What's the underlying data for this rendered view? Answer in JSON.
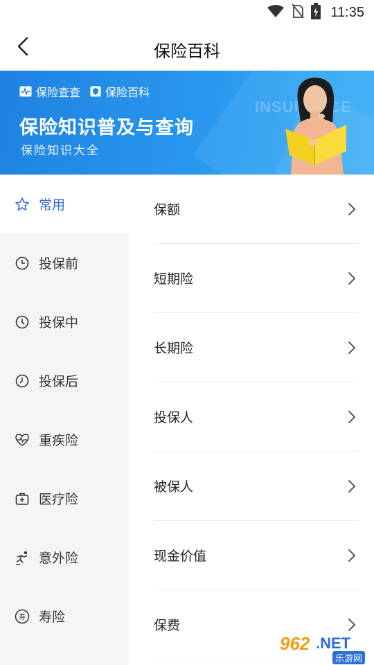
{
  "status_bar": {
    "time": "11:35",
    "icons": [
      "wifi-icon",
      "no-sim-icon",
      "battery-charging-icon"
    ]
  },
  "header": {
    "title": "保险百科",
    "back_icon": "chevron-left-icon"
  },
  "banner": {
    "tag_1": "保险查查",
    "tag_2": "保险百科",
    "headline": "保险知识普及与查询",
    "subline": "保险知识大全",
    "watermark": "INSURANCE",
    "colors": {
      "start": "#1e82e0",
      "end": "#37aef7"
    }
  },
  "sidebar": {
    "active_index": 0,
    "active_color": "#2f6fd8",
    "items": [
      {
        "label": "常用",
        "icon": "star-icon"
      },
      {
        "label": "投保前",
        "icon": "clock-icon"
      },
      {
        "label": "投保中",
        "icon": "clock-icon"
      },
      {
        "label": "投保后",
        "icon": "clock-icon"
      },
      {
        "label": "重疾险",
        "icon": "heartbeat-icon"
      },
      {
        "label": "医疗险",
        "icon": "medical-kit-icon"
      },
      {
        "label": "意外险",
        "icon": "falling-person-icon"
      },
      {
        "label": "寿险",
        "icon": "longevity-icon"
      }
    ]
  },
  "list": {
    "items": [
      "保额",
      "短期险",
      "长期险",
      "投保人",
      "被保人",
      "现金价值",
      "保费"
    ]
  },
  "corner_watermark": {
    "number": "962",
    "suffix": ".NET",
    "site_cn": "乐游网"
  }
}
